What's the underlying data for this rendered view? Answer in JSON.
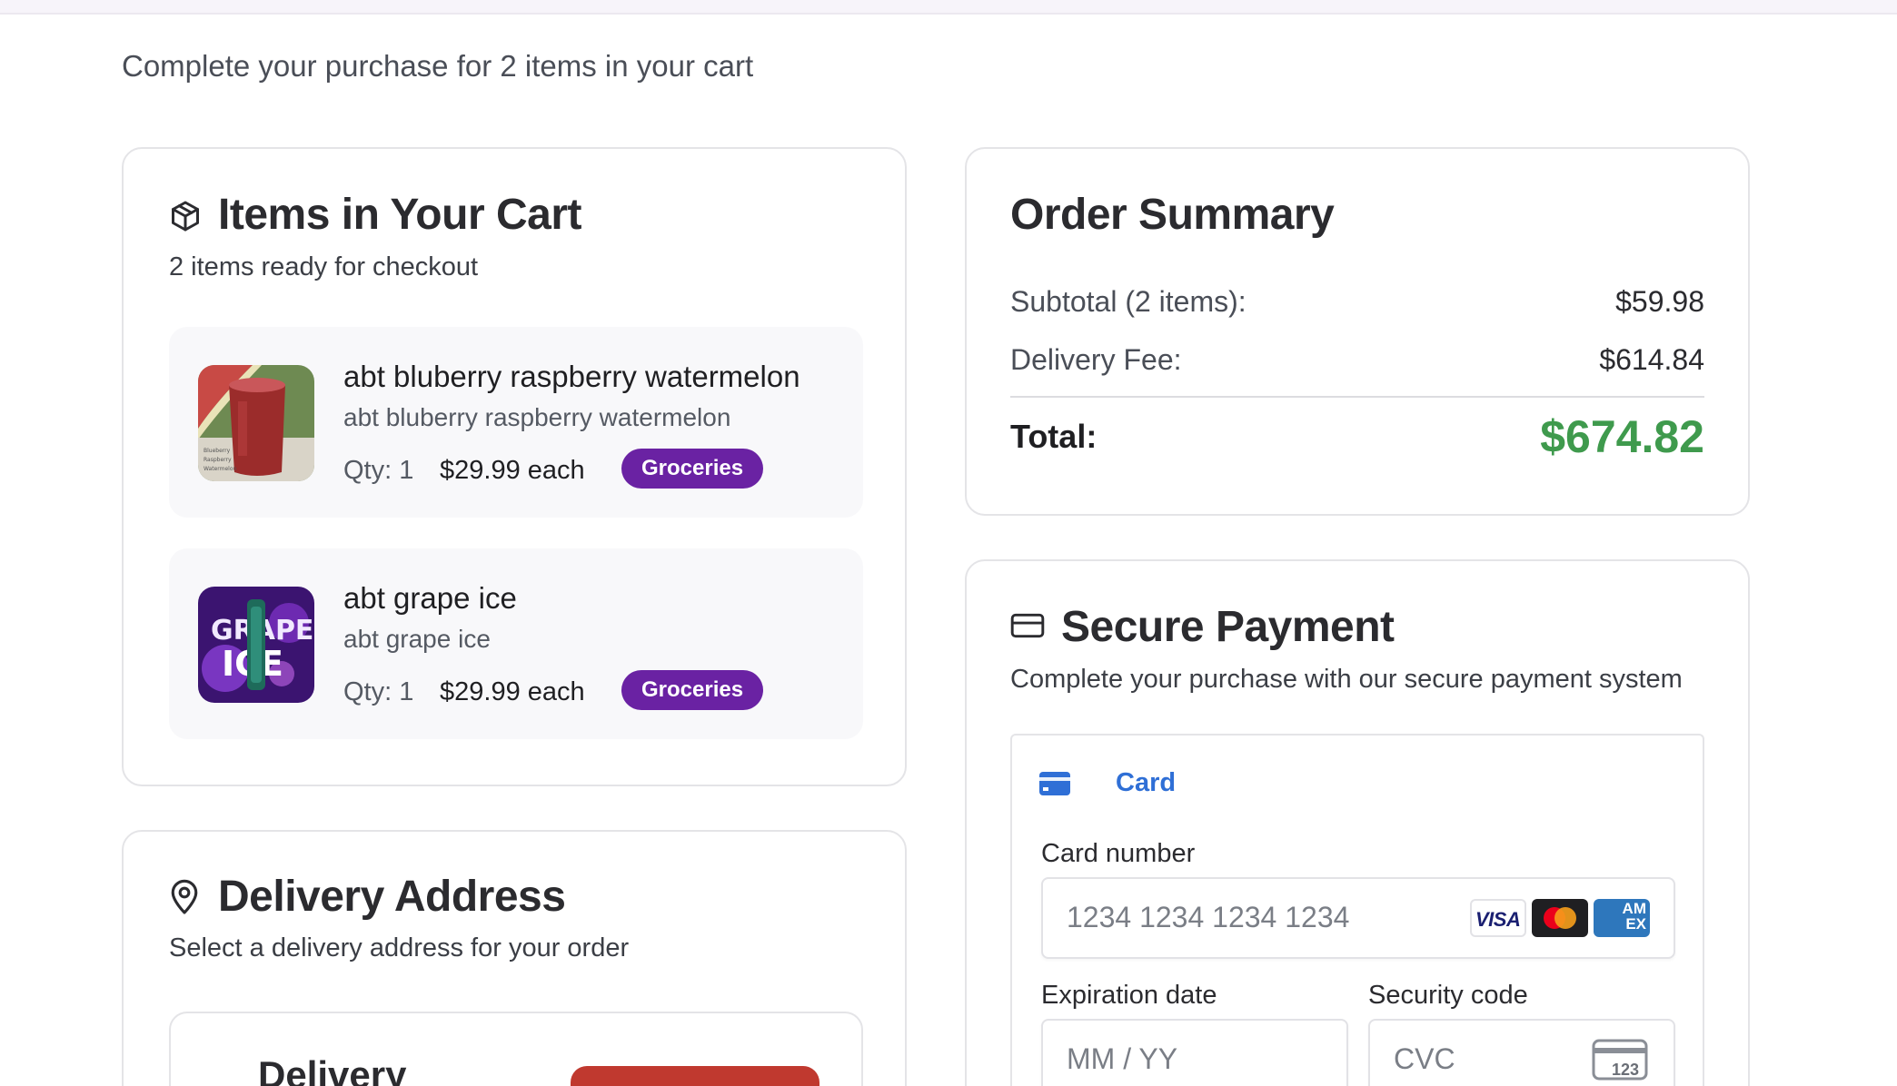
{
  "page": {
    "subtitle": "Complete your purchase for 2 items in your cart"
  },
  "cart": {
    "title": "Items in Your Cart",
    "subtitle": "2 items ready for checkout",
    "icon": "package-icon",
    "items": [
      {
        "name": "abt bluberry raspberry watermelon",
        "description": "abt bluberry raspberry watermelon",
        "qty": "Qty: 1",
        "price": "$29.99 each",
        "category": "Groceries",
        "thumb_colors": [
          "#5e1b17",
          "#b23a38",
          "#6f8f4a"
        ]
      },
      {
        "name": "abt grape ice",
        "description": "abt grape ice",
        "qty": "Qty: 1",
        "price": "$29.99 each",
        "category": "Groceries",
        "thumb_colors": [
          "#3b1470",
          "#8a3fd6",
          "#1e6b5a"
        ]
      }
    ]
  },
  "summary": {
    "title": "Order Summary",
    "subtotal_label": "Subtotal (2 items):",
    "subtotal_value": "$59.98",
    "delivery_label": "Delivery Fee:",
    "delivery_value": "$614.84",
    "total_label": "Total:",
    "total_value": "$674.82",
    "total_color": "#3f9a4d"
  },
  "payment": {
    "title": "Secure Payment",
    "subtitle": "Complete your purchase with our secure payment system",
    "icon": "credit-card-icon",
    "tab_label": "Card",
    "card_number_label": "Card number",
    "card_number_placeholder": "1234 1234 1234 1234",
    "expiry_label": "Expiration date",
    "expiry_placeholder": "MM / YY",
    "cvc_label": "Security code",
    "cvc_placeholder": "CVC",
    "cvc_icon_text": "123",
    "brands": [
      "VISA",
      "mastercard",
      "AMEX"
    ],
    "brand_text": {
      "visa": "VISA",
      "amex": "AM EX"
    },
    "accent_color": "#2f6fd6"
  },
  "delivery": {
    "title": "Delivery Address",
    "subtitle": "Select a delivery address for your order",
    "icon": "map-pin-icon",
    "option_title": "Delivery"
  }
}
